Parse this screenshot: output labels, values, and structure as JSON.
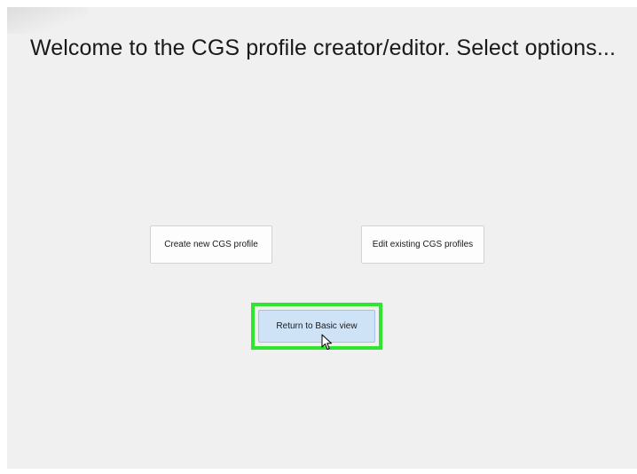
{
  "header": {
    "title": "Welcome to the CGS profile creator/editor. Select options..."
  },
  "buttons": {
    "create_label": "Create new CGS profile",
    "edit_label": "Edit existing CGS profiles",
    "return_label": "Return to Basic view"
  },
  "highlight_color": "#2ee62e",
  "icons": {
    "cursor": "mouse-pointer-icon"
  }
}
